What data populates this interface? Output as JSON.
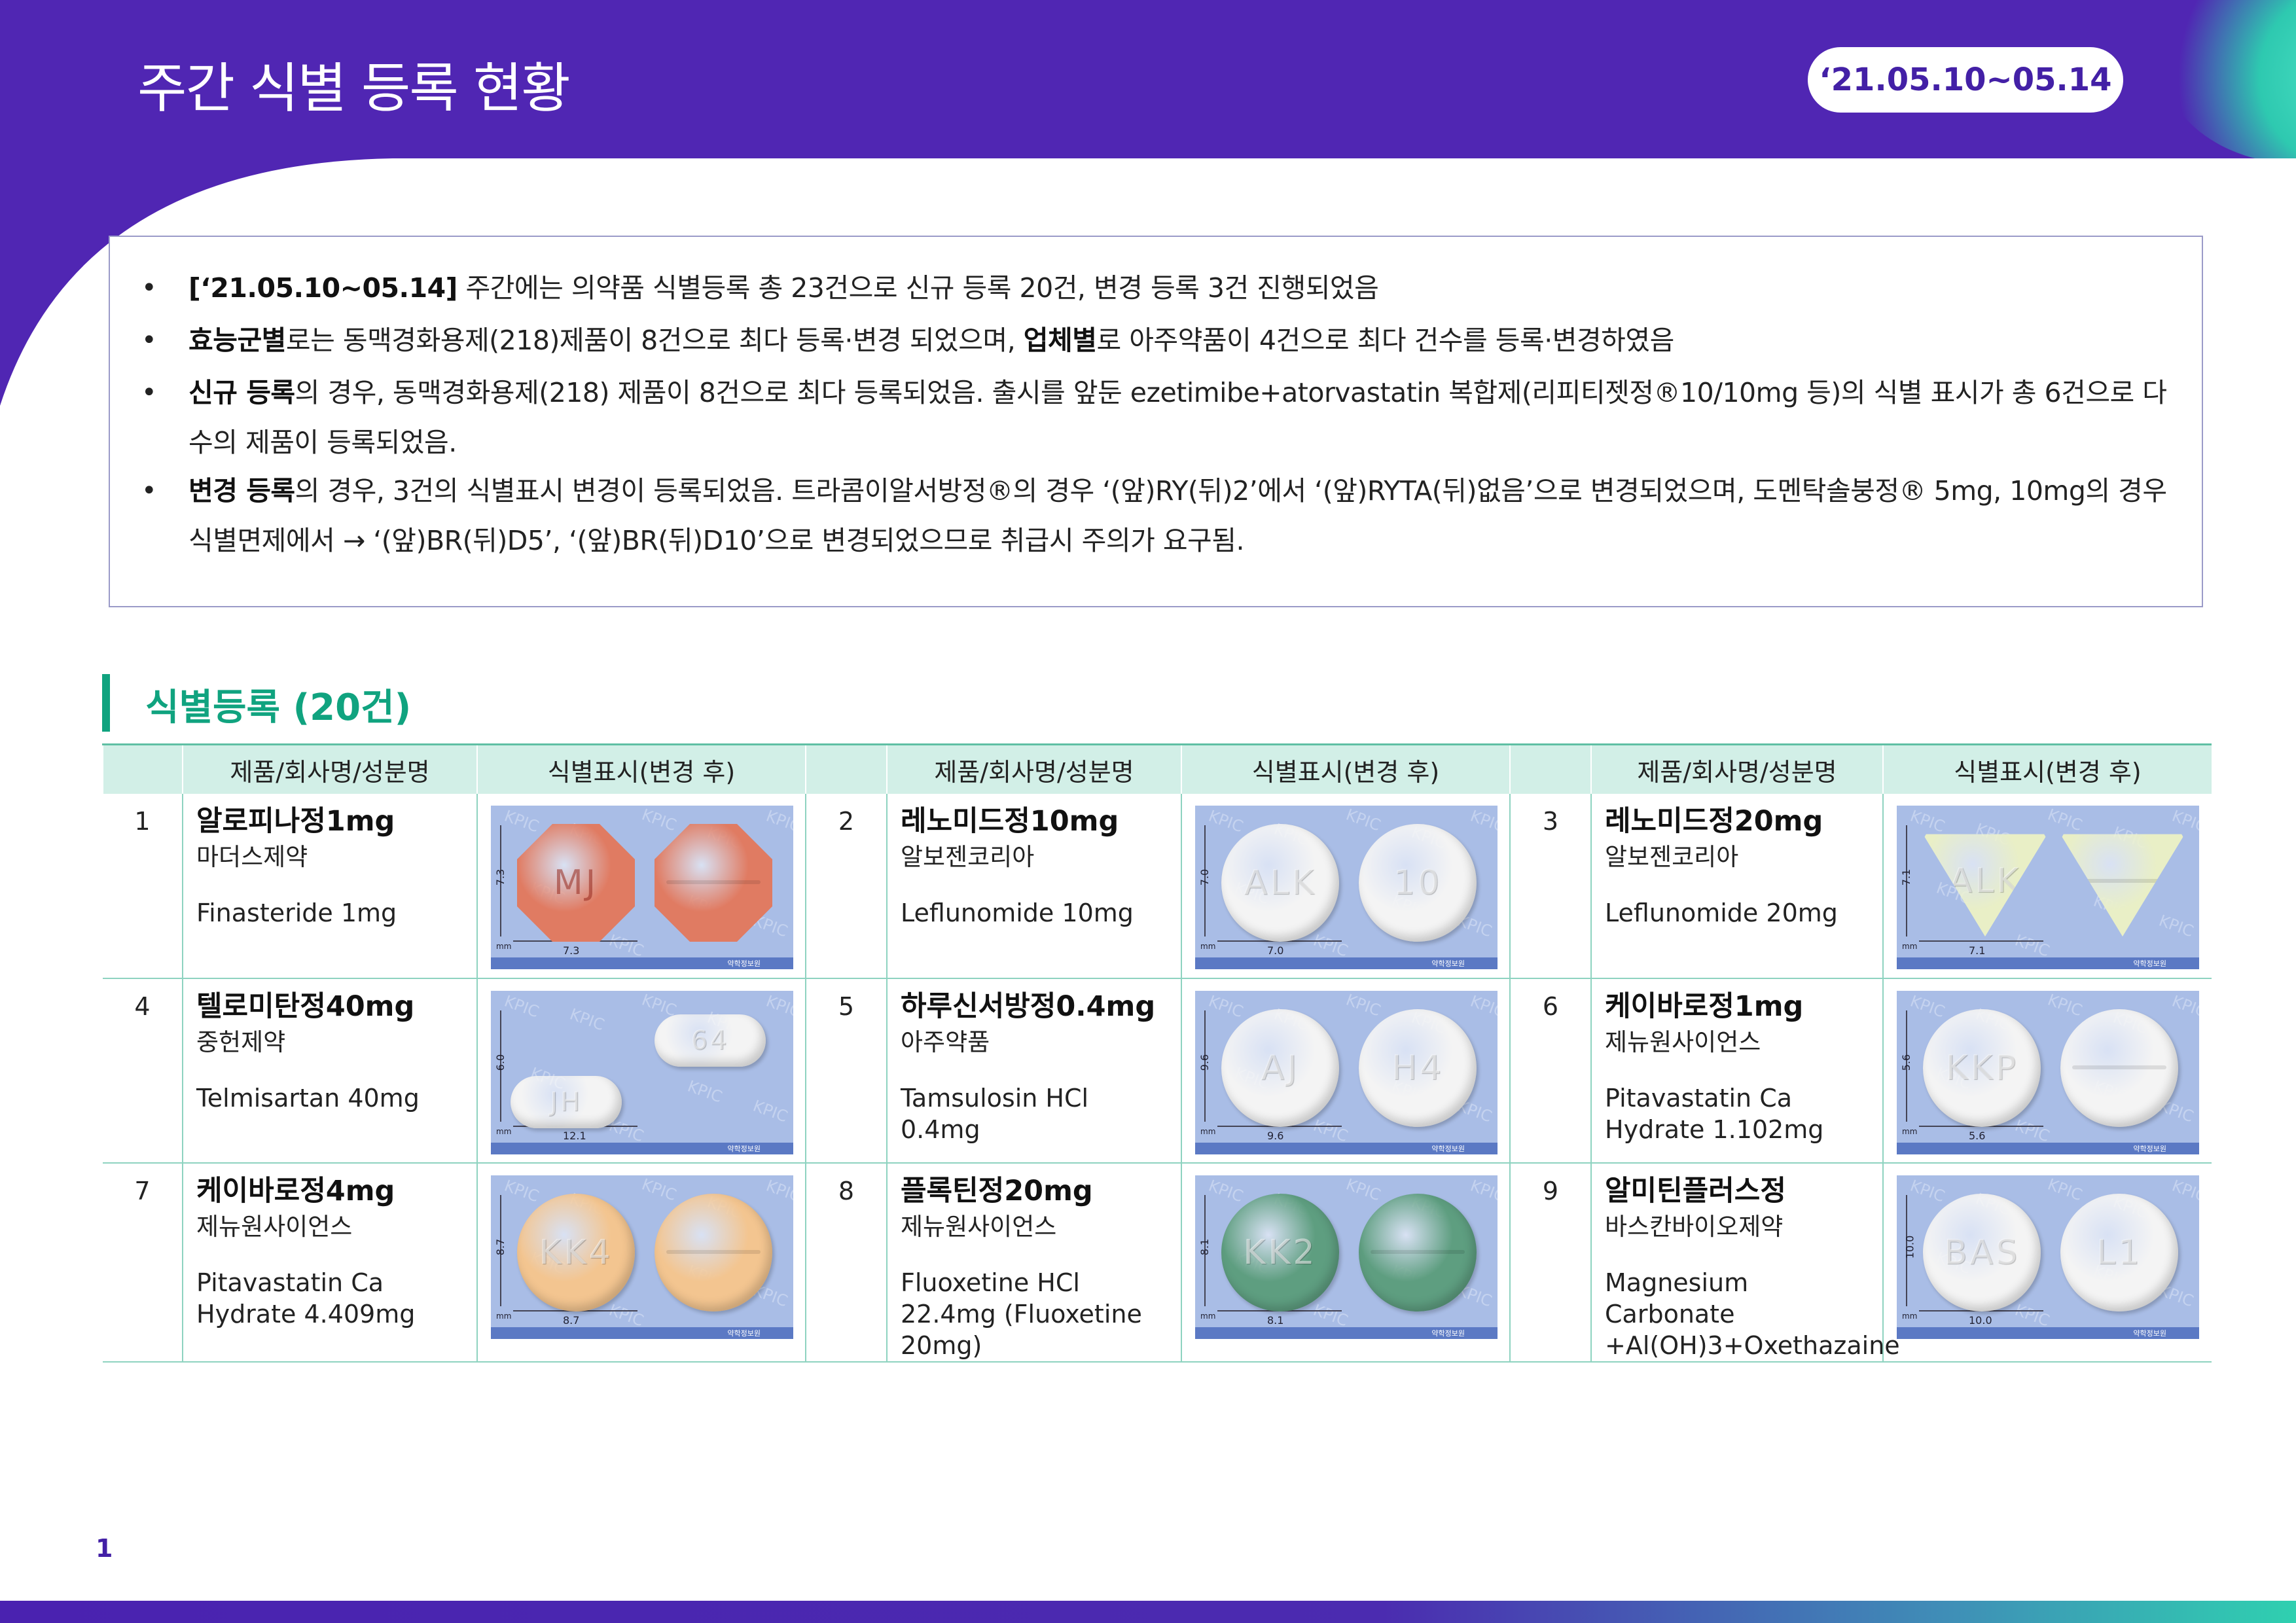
{
  "header": {
    "title": "주간 식별 등록 현황",
    "date_range": "‘21.05.10~05.14"
  },
  "summary": {
    "items": [
      {
        "segments": [
          {
            "t": "[‘21.05.10~05.14]",
            "b": true
          },
          {
            "t": " 주간에는 의약품 식별등록 총 23건으로 신규 등록 20건, 변경 등록 3건 진행되었음",
            "b": false
          }
        ]
      },
      {
        "segments": [
          {
            "t": "효능군별",
            "b": true
          },
          {
            "t": "로는 동맥경화용제(218)제품이 8건으로 최다 등록·변경 되었으며, ",
            "b": false
          },
          {
            "t": "업체별",
            "b": true
          },
          {
            "t": "로 아주약품이 4건으로 최다 건수를 등록·변경하였음",
            "b": false
          }
        ]
      },
      {
        "segments": [
          {
            "t": "신규 등록",
            "b": true
          },
          {
            "t": "의 경우, 동맥경화용제(218) 제품이 8건으로 최다 등록되었음. 출시를 앞둔 ezetimibe+atorvastatin 복합제(리피티젯정®10/10mg 등)의 식별 표시가 총 6건으로 다수의 제품이 등록되었음.",
            "b": false
          }
        ]
      },
      {
        "segments": [
          {
            "t": "변경 등록",
            "b": true
          },
          {
            "t": "의 경우, 3건의 식별표시 변경이 등록되었음. 트라콤이알서방정®의 경우 ‘(앞)RY(뒤)2’에서 ‘(앞)RYTA(뒤)없음’으로 변경되었으며, 도멘탁솔붕정® 5mg, 10mg의 경우 식별면제에서 → ‘(앞)BR(뒤)D5’, ‘(앞)BR(뒤)D10’으로 변경되었으므로 취급시 주의가 요구됨.",
            "b": false
          }
        ]
      }
    ]
  },
  "section": {
    "title": "식별등록 (20건)"
  },
  "table": {
    "headers": [
      "",
      "제품/회사명/성분명",
      "식별표시(변경 후)",
      "",
      "제품/회사명/성분명",
      "식별표시(변경 후)",
      "",
      "제품/회사명/성분명",
      "식별표시(변경 후)"
    ],
    "items": [
      {
        "no": "1",
        "name": "알로피나정1mg",
        "company": "마더스제약",
        "ingredient": "Finasteride 1mg",
        "front": "MJ",
        "back": "",
        "color": "#e07b62",
        "shape": "octagon",
        "height_label": "7.3",
        "width_label": "7.3"
      },
      {
        "no": "2",
        "name": "레노미드정10mg",
        "company": "알보젠코리아",
        "ingredient": "Leflunomide 10mg",
        "front": "ALK",
        "back": "10",
        "color": "#f4f4f4",
        "shape": "round",
        "height_label": "7.0",
        "width_label": "7.0"
      },
      {
        "no": "3",
        "name": "레노미드정20mg",
        "company": "알보젠코리아",
        "ingredient": "Leflunomide 20mg",
        "front": "ALK",
        "back": "",
        "color": "#e9efc6",
        "shape": "triangle",
        "height_label": "7.1",
        "width_label": "7.1"
      },
      {
        "no": "4",
        "name": "텔로미탄정40mg",
        "company": "중헌제약",
        "ingredient": "Telmisartan 40mg",
        "front": "JH",
        "back": "64",
        "color": "#f4f4f4",
        "shape": "oblong",
        "height_label": "6.0",
        "width_label": "12.1"
      },
      {
        "no": "5",
        "name": "하루신서방정0.4mg",
        "company": "아주약품",
        "ingredient": "Tamsulosin HCl 0.4mg",
        "front": "AJ",
        "back": "H4",
        "color": "#f4f4f4",
        "shape": "round",
        "height_label": "9.6",
        "width_label": "9.6"
      },
      {
        "no": "6",
        "name": "케이바로정1mg",
        "company": "제뉴원사이언스",
        "ingredient": "Pitavastatin Ca Hydrate 1.102mg",
        "front": "KKP",
        "back": "",
        "color": "#f4f4f4",
        "shape": "round",
        "height_label": "5.6",
        "width_label": "5.6"
      },
      {
        "no": "7",
        "name": "케이바로정4mg",
        "company": "제뉴원사이언스",
        "ingredient": "Pitavastatin Ca Hydrate 4.409mg",
        "front": "KK4",
        "back": "",
        "color": "#f3c590",
        "shape": "round",
        "height_label": "8.7",
        "width_label": "8.7"
      },
      {
        "no": "8",
        "name": "플록틴정20mg",
        "company": "제뉴원사이언스",
        "ingredient": "Fluoxetine HCl 22.4mg (Fluoxetine 20mg)",
        "front": "KK2",
        "back": "",
        "color": "#5e9e80",
        "shape": "round",
        "height_label": "8.1",
        "width_label": "8.1"
      },
      {
        "no": "9",
        "name": "알미틴플러스정",
        "company": "바스칸바이오제약",
        "ingredient": "Magnesium Carbonate +Al(OH)3+Oxethazaine",
        "front": "BAS",
        "back": "L1",
        "color": "#f4f4f4",
        "shape": "round",
        "height_label": "10.0",
        "width_label": "10.0"
      }
    ],
    "image_watermark": "KPIC",
    "image_unit": "mm",
    "image_footer": "약학정보원"
  },
  "page": {
    "number": "1"
  },
  "colors": {
    "brand_purple": "#5026b3",
    "accent_green": "#10a37f",
    "header_row": "#d2efe7"
  }
}
